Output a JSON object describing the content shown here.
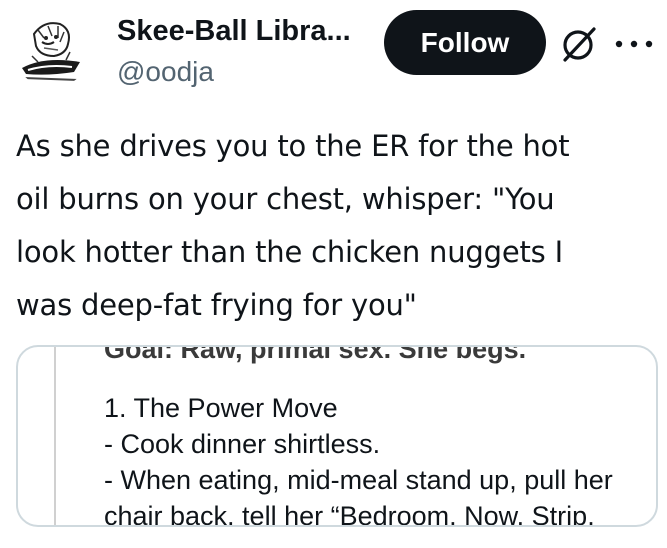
{
  "author": {
    "display_name": "Skee-Ball Libra...",
    "handle": "@oodja"
  },
  "actions": {
    "follow_label": "Follow",
    "grok_icon": "grok-icon",
    "more_icon": "more-dots-icon"
  },
  "tweet": {
    "text": "As she drives you to the ER for the hot\noil burns on your chest, whisper: \"You\nlook hotter than the chicken nuggets I\nwas deep-fat frying for you\""
  },
  "media": {
    "lines": [
      "Goal: Raw, primal sex. She begs.",
      "1. The Power Move",
      "- Cook dinner shirtless.",
      "- When eating, mid-meal stand up, pull her",
      "chair back, tell her “Bedroom. Now. Strip."
    ]
  },
  "colors": {
    "text": "#0f1419",
    "secondary_text": "#536471",
    "follow_bg": "#0f1419",
    "card_border": "#cfd9de"
  }
}
